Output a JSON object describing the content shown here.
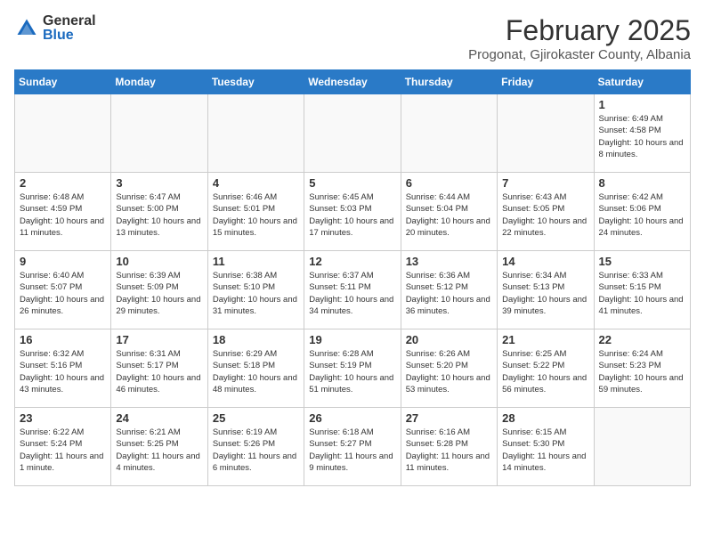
{
  "header": {
    "logo_general": "General",
    "logo_blue": "Blue",
    "month_title": "February 2025",
    "subtitle": "Progonat, Gjirokaster County, Albania"
  },
  "weekdays": [
    "Sunday",
    "Monday",
    "Tuesday",
    "Wednesday",
    "Thursday",
    "Friday",
    "Saturday"
  ],
  "weeks": [
    [
      {
        "day": "",
        "info": ""
      },
      {
        "day": "",
        "info": ""
      },
      {
        "day": "",
        "info": ""
      },
      {
        "day": "",
        "info": ""
      },
      {
        "day": "",
        "info": ""
      },
      {
        "day": "",
        "info": ""
      },
      {
        "day": "1",
        "info": "Sunrise: 6:49 AM\nSunset: 4:58 PM\nDaylight: 10 hours\nand 8 minutes."
      }
    ],
    [
      {
        "day": "2",
        "info": "Sunrise: 6:48 AM\nSunset: 4:59 PM\nDaylight: 10 hours\nand 11 minutes."
      },
      {
        "day": "3",
        "info": "Sunrise: 6:47 AM\nSunset: 5:00 PM\nDaylight: 10 hours\nand 13 minutes."
      },
      {
        "day": "4",
        "info": "Sunrise: 6:46 AM\nSunset: 5:01 PM\nDaylight: 10 hours\nand 15 minutes."
      },
      {
        "day": "5",
        "info": "Sunrise: 6:45 AM\nSunset: 5:03 PM\nDaylight: 10 hours\nand 17 minutes."
      },
      {
        "day": "6",
        "info": "Sunrise: 6:44 AM\nSunset: 5:04 PM\nDaylight: 10 hours\nand 20 minutes."
      },
      {
        "day": "7",
        "info": "Sunrise: 6:43 AM\nSunset: 5:05 PM\nDaylight: 10 hours\nand 22 minutes."
      },
      {
        "day": "8",
        "info": "Sunrise: 6:42 AM\nSunset: 5:06 PM\nDaylight: 10 hours\nand 24 minutes."
      }
    ],
    [
      {
        "day": "9",
        "info": "Sunrise: 6:40 AM\nSunset: 5:07 PM\nDaylight: 10 hours\nand 26 minutes."
      },
      {
        "day": "10",
        "info": "Sunrise: 6:39 AM\nSunset: 5:09 PM\nDaylight: 10 hours\nand 29 minutes."
      },
      {
        "day": "11",
        "info": "Sunrise: 6:38 AM\nSunset: 5:10 PM\nDaylight: 10 hours\nand 31 minutes."
      },
      {
        "day": "12",
        "info": "Sunrise: 6:37 AM\nSunset: 5:11 PM\nDaylight: 10 hours\nand 34 minutes."
      },
      {
        "day": "13",
        "info": "Sunrise: 6:36 AM\nSunset: 5:12 PM\nDaylight: 10 hours\nand 36 minutes."
      },
      {
        "day": "14",
        "info": "Sunrise: 6:34 AM\nSunset: 5:13 PM\nDaylight: 10 hours\nand 39 minutes."
      },
      {
        "day": "15",
        "info": "Sunrise: 6:33 AM\nSunset: 5:15 PM\nDaylight: 10 hours\nand 41 minutes."
      }
    ],
    [
      {
        "day": "16",
        "info": "Sunrise: 6:32 AM\nSunset: 5:16 PM\nDaylight: 10 hours\nand 43 minutes."
      },
      {
        "day": "17",
        "info": "Sunrise: 6:31 AM\nSunset: 5:17 PM\nDaylight: 10 hours\nand 46 minutes."
      },
      {
        "day": "18",
        "info": "Sunrise: 6:29 AM\nSunset: 5:18 PM\nDaylight: 10 hours\nand 48 minutes."
      },
      {
        "day": "19",
        "info": "Sunrise: 6:28 AM\nSunset: 5:19 PM\nDaylight: 10 hours\nand 51 minutes."
      },
      {
        "day": "20",
        "info": "Sunrise: 6:26 AM\nSunset: 5:20 PM\nDaylight: 10 hours\nand 53 minutes."
      },
      {
        "day": "21",
        "info": "Sunrise: 6:25 AM\nSunset: 5:22 PM\nDaylight: 10 hours\nand 56 minutes."
      },
      {
        "day": "22",
        "info": "Sunrise: 6:24 AM\nSunset: 5:23 PM\nDaylight: 10 hours\nand 59 minutes."
      }
    ],
    [
      {
        "day": "23",
        "info": "Sunrise: 6:22 AM\nSunset: 5:24 PM\nDaylight: 11 hours\nand 1 minute."
      },
      {
        "day": "24",
        "info": "Sunrise: 6:21 AM\nSunset: 5:25 PM\nDaylight: 11 hours\nand 4 minutes."
      },
      {
        "day": "25",
        "info": "Sunrise: 6:19 AM\nSunset: 5:26 PM\nDaylight: 11 hours\nand 6 minutes."
      },
      {
        "day": "26",
        "info": "Sunrise: 6:18 AM\nSunset: 5:27 PM\nDaylight: 11 hours\nand 9 minutes."
      },
      {
        "day": "27",
        "info": "Sunrise: 6:16 AM\nSunset: 5:28 PM\nDaylight: 11 hours\nand 11 minutes."
      },
      {
        "day": "28",
        "info": "Sunrise: 6:15 AM\nSunset: 5:30 PM\nDaylight: 11 hours\nand 14 minutes."
      },
      {
        "day": "",
        "info": ""
      }
    ]
  ]
}
